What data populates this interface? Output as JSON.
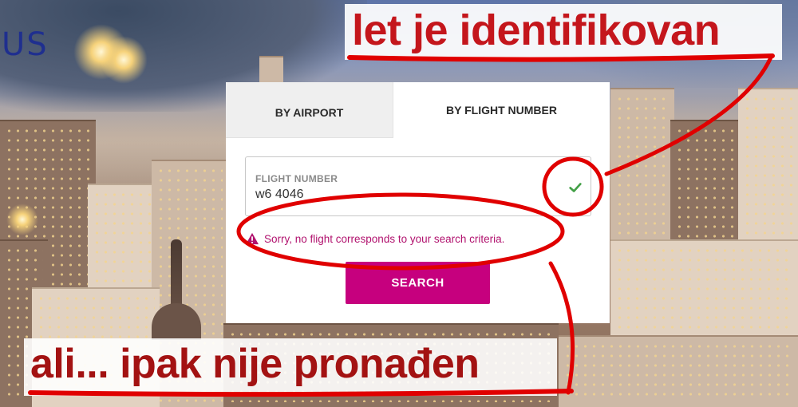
{
  "brand": {
    "partial_text": "US"
  },
  "tabs": [
    {
      "label": "BY AIRPORT",
      "active": false
    },
    {
      "label": "BY FLIGHT NUMBER",
      "active": true
    }
  ],
  "form": {
    "field_label": "FLIGHT NUMBER",
    "field_value": "w6 4046",
    "valid_icon": "check-icon",
    "error_icon": "warning-triangle-icon",
    "error_message": "Sorry, no flight corresponds to your search criteria.",
    "search_label": "SEARCH"
  },
  "annotations": {
    "top_text": "let je identifikovan",
    "bottom_text": "ali... ipak nije pronađen",
    "color": "#e00000"
  },
  "colors": {
    "accent": "#c6007e",
    "error_text": "#b1126e",
    "success_check": "#43a047",
    "brand": "#1f2f8f"
  }
}
